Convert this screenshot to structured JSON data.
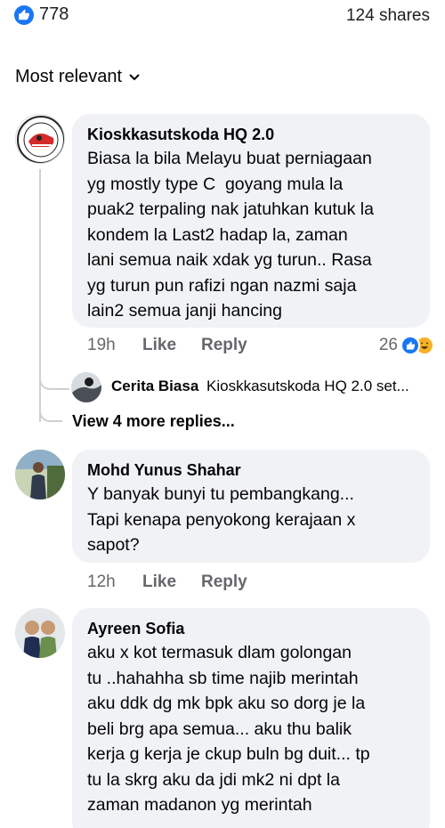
{
  "stats": {
    "like_count": "778",
    "shares": "124 shares"
  },
  "sort": {
    "label": "Most relevant"
  },
  "comments": [
    {
      "author": "Kioskkasutskoda HQ 2.0",
      "text": "Biasa la bila Melayu buat perniagaan\nyg mostly type C  goyang mula la\npuak2 terpaling nak jatuhkan kutuk la\nkondem la Last2 hadap la, zaman\nlani semua naik xdak yg turun.. Rasa\nyg turun pun rafizi ngan nazmi saja\nlain2 semua janji hancing",
      "time": "19h",
      "like": "Like",
      "reply": "Reply",
      "reaction_count": "26"
    },
    {
      "author": "Mohd Yunus Shahar",
      "text": "Y banyak bunyi tu pembangkang...\nTapi kenapa penyokong kerajaan x\nsapot?",
      "time": "12h",
      "like": "Like",
      "reply": "Reply"
    },
    {
      "author": "Ayreen Sofia",
      "text": "aku x kot termasuk dlam golongan\ntu ..hahahha sb time najib merintah\naku ddk dg mk bpk aku so dorg je la\nbeli brg apa semua... aku thu balik\nkerja g kerja je ckup buln bg duit... tp\ntu la skrg aku da jdi mk2 ni dpt la\nzaman madanon yg merintah"
    }
  ],
  "reply_preview": {
    "author": "Cerita Biasa",
    "snippet": "Kioskkasutskoda HQ 2.0  set..."
  },
  "more_replies": "View 4 more replies...",
  "colors": {
    "like_blue": "#1877f2",
    "bubble_bg": "#f0f2f5",
    "meta_gray": "#65676b",
    "haha_yellow": "#f7b125",
    "logo_red": "#d42a2a"
  }
}
